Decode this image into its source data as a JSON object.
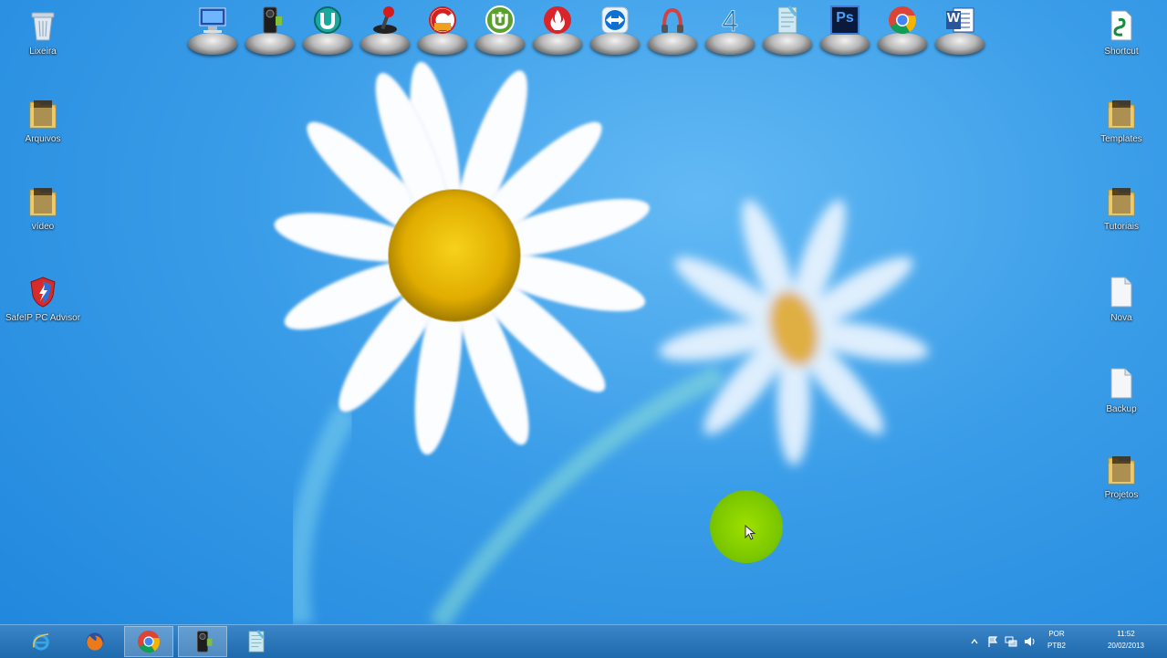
{
  "desktop_left": [
    {
      "id": "recycle-bin",
      "label": "Lixeira",
      "icon": "recycle-bin-icon"
    },
    {
      "id": "folder-1",
      "label": "Arquivos",
      "icon": "folder-icon"
    },
    {
      "id": "folder-2",
      "label": "vídeo",
      "icon": "folder-icon"
    },
    {
      "id": "security-app",
      "label": "SafeIP PC Advisor",
      "icon": "shield-icon"
    }
  ],
  "desktop_right": [
    {
      "id": "shortcut-top",
      "label": "Shortcut",
      "icon": "application-icon"
    },
    {
      "id": "folder-r1",
      "label": "Templates",
      "icon": "folder-icon"
    },
    {
      "id": "folder-r2",
      "label": "Tutoriais",
      "icon": "folder-icon"
    },
    {
      "id": "file-r1",
      "label": "Nova",
      "icon": "file-icon"
    },
    {
      "id": "file-r2",
      "label": "Backup",
      "icon": "file-icon"
    },
    {
      "id": "folder-r3",
      "label": "Projetos",
      "icon": "folder-icon"
    }
  ],
  "dock": [
    {
      "id": "this-pc",
      "icon": "computer-icon"
    },
    {
      "id": "camera-tool",
      "icon": "camera-icon"
    },
    {
      "id": "uninstaller",
      "icon": "uninstaller-icon"
    },
    {
      "id": "game-joystick",
      "icon": "joystick-icon"
    },
    {
      "id": "ccleaner",
      "icon": "ccleaner-icon"
    },
    {
      "id": "utorrent",
      "icon": "utorrent-icon"
    },
    {
      "id": "burner",
      "icon": "flame-disc-icon"
    },
    {
      "id": "teamviewer",
      "icon": "teamviewer-icon"
    },
    {
      "id": "recorder",
      "icon": "recorder-icon"
    },
    {
      "id": "four-app",
      "icon": "four-icon"
    },
    {
      "id": "notepad",
      "icon": "notepad-icon"
    },
    {
      "id": "photoshop",
      "icon": "photoshop-icon",
      "label": "Ps"
    },
    {
      "id": "chrome",
      "icon": "chrome-icon"
    },
    {
      "id": "word",
      "icon": "word-icon",
      "label": "W"
    }
  ],
  "taskbar": [
    {
      "id": "internet-explorer",
      "icon": "internet-explorer-icon",
      "active": false
    },
    {
      "id": "firefox",
      "icon": "firefox-icon",
      "active": false
    },
    {
      "id": "chrome",
      "icon": "chrome-icon",
      "active": true
    },
    {
      "id": "camera-app",
      "icon": "camera-icon",
      "active": true
    },
    {
      "id": "notepad-app",
      "icon": "notepad-icon",
      "active": false
    }
  ],
  "tray": {
    "lang_top": "POR",
    "lang_bottom": "PTB2",
    "time": "11:52",
    "date": "20/02/2013"
  },
  "colors": {
    "sky": "#3a9de8",
    "taskbar": "#2b78bd",
    "cursor_halo": "#7cc800"
  }
}
